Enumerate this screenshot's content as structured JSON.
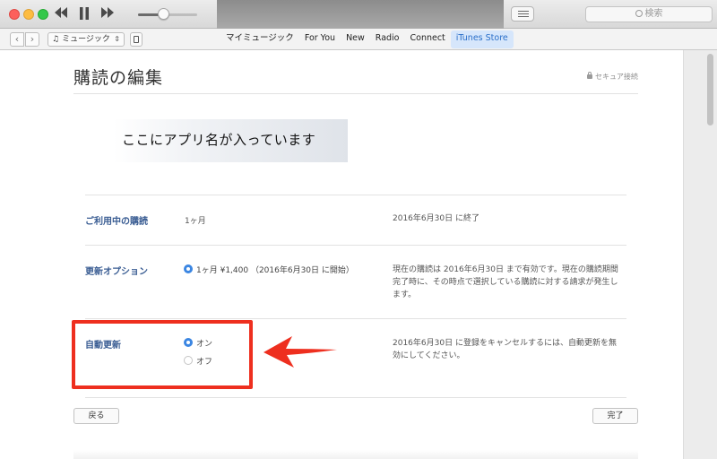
{
  "toolbar": {
    "search_placeholder": "検索",
    "volume_level": 0.42
  },
  "nav": {
    "back_label": "‹",
    "forward_label": "›",
    "media_kind": "ミュージック",
    "tabs": [
      {
        "label": "マイミュージック"
      },
      {
        "label": "For You"
      },
      {
        "label": "New"
      },
      {
        "label": "Radio"
      },
      {
        "label": "Connect"
      },
      {
        "label": "iTunes Store"
      }
    ]
  },
  "page": {
    "title": "購読の編集",
    "secure_label": "セキュア接続",
    "app_name": "ここにアプリ名が入っています",
    "rows": {
      "current": {
        "label": "ご利用中の購読",
        "value": "1ヶ月",
        "description": "2016年6月30日 に終了"
      },
      "renewal": {
        "label": "更新オプション",
        "option": "1ヶ月 ¥1,400 （2016年6月30日 に開始）",
        "description": "現在の購読は 2016年6月30日 まで有効です。現在の購読期間完了時に、その時点で選択している購読に対する請求が発生します。"
      },
      "auto_renew": {
        "label": "自動更新",
        "on_label": "オン",
        "off_label": "オフ",
        "selected": "オン",
        "description": "2016年6月30日 に登録をキャンセルするには、自動更新を無効にしてください。"
      }
    },
    "back_button": "戻る",
    "done_button": "完了"
  },
  "colors": {
    "accent": "#2a6fc9",
    "label_blue": "#3a5d93",
    "annotation_red": "#ee2f1f",
    "radio_selected": "#3b86e2"
  }
}
